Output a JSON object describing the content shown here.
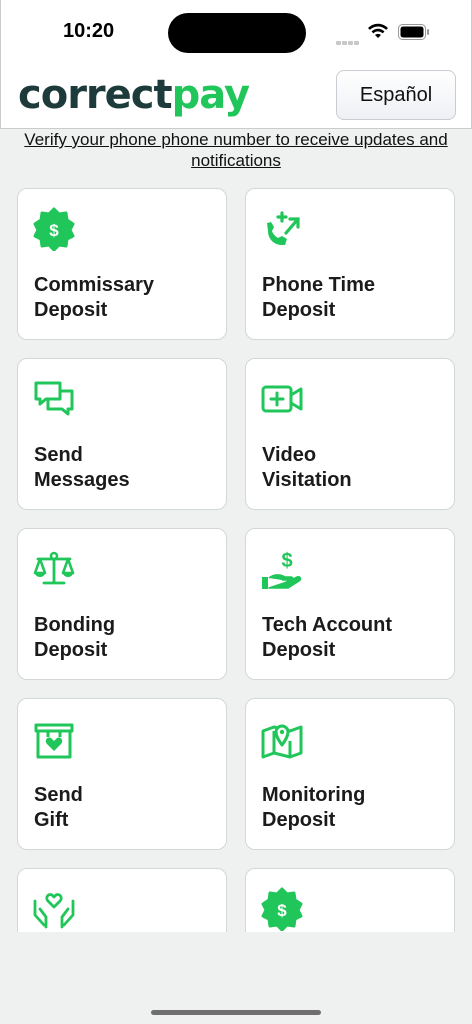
{
  "status_bar": {
    "time": "10:20"
  },
  "header": {
    "logo_part1": "correct",
    "logo_part2": "pay",
    "language_button": "Español"
  },
  "verify": {
    "line1": "Verify your phone phone number to receive updates and",
    "line2": "notifications"
  },
  "colors": {
    "accent": "#20c659",
    "logo_dark": "#1d3b3a",
    "background": "#eff1f1"
  },
  "cards": [
    {
      "line1": "Commissary",
      "line2": "Deposit",
      "icon": "dollar-badge-icon"
    },
    {
      "line1": "Phone Time",
      "line2": "Deposit",
      "icon": "phone-plus-icon"
    },
    {
      "line1": "Send",
      "line2": "Messages",
      "icon": "chat-bubbles-icon"
    },
    {
      "line1": "Video",
      "line2": "Visitation",
      "icon": "video-plus-icon"
    },
    {
      "line1": "Bonding",
      "line2": "Deposit",
      "icon": "scale-icon"
    },
    {
      "line1": "Tech Account",
      "line2": "Deposit",
      "icon": "hand-dollar-icon"
    },
    {
      "line1": "Send",
      "line2": "Gift",
      "icon": "gift-box-heart-icon"
    },
    {
      "line1": "Monitoring",
      "line2": "Deposit",
      "icon": "map-pin-icon"
    },
    {
      "line1": "",
      "line2": "",
      "icon": "hands-heart-icon"
    },
    {
      "line1": "",
      "line2": "",
      "icon": "dollar-badge-icon"
    }
  ]
}
